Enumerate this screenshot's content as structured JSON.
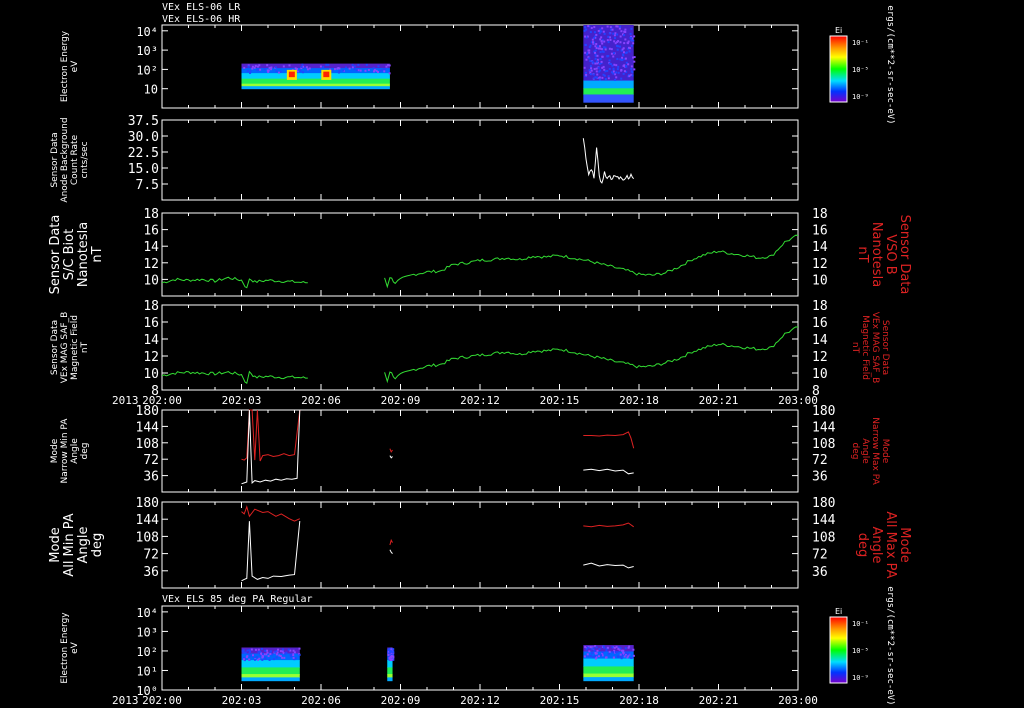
{
  "header": {
    "line1": "VEx ELS-06 LR",
    "line2": "VEx ELS-06 HR"
  },
  "colorbar_units": "ergs/(cm**2-sr-sec-eV)",
  "colorbar_label": "Ei",
  "time_axis": {
    "year": "2013",
    "tick_labels": [
      "202:00",
      "202:03",
      "202:06",
      "202:09",
      "202:12",
      "202:15",
      "202:18",
      "202:21",
      "203:00"
    ],
    "range_hours": [
      0,
      24
    ]
  },
  "chart_data": [
    {
      "panel": "electron-energy-top",
      "type": "heatmap",
      "ylabel": [
        "Electron Energy",
        "eV"
      ],
      "yscale": "log",
      "ylim": [
        1,
        20000
      ],
      "ytick_labels": [
        "10",
        "10²",
        "10³",
        "10⁴"
      ],
      "colorbar": {
        "label": "Ei",
        "ticks": [
          "10⁻¹",
          "10⁻⁵",
          "10⁻⁹"
        ]
      },
      "data_blocks": [
        {
          "t_start": 3.0,
          "t_end": 8.6,
          "e_min": 10,
          "e_max": 200,
          "hotspots_hours": [
            4.9,
            6.2
          ]
        },
        {
          "t_start": 15.9,
          "t_end": 17.8,
          "e_min": 2,
          "e_max": 20000,
          "hotspots_hours": []
        }
      ]
    },
    {
      "panel": "anode-background",
      "type": "line",
      "ylabel": [
        "Sensor Data",
        "Anode Background",
        "Count Rate",
        "cnts/sec"
      ],
      "ylim": [
        0,
        37.5
      ],
      "ytick_labels": [
        "37.5",
        "30.0",
        "22.5",
        "15.0",
        "7.5"
      ],
      "ytick_values": [
        37.5,
        30.0,
        22.5,
        15.0,
        7.5
      ],
      "color": "#ffffff",
      "series": [
        {
          "x": [
            15.9,
            16.0,
            16.1,
            16.2,
            16.3,
            16.4,
            16.5,
            16.6,
            16.7,
            16.8,
            16.9,
            17.0,
            17.1,
            17.2,
            17.3,
            17.4,
            17.5,
            17.6,
            17.7,
            17.8
          ],
          "y": [
            29,
            20,
            12,
            15,
            10,
            25,
            11,
            8,
            13,
            10,
            12,
            9,
            12,
            10,
            11,
            9,
            11,
            10,
            12,
            10
          ]
        }
      ]
    },
    {
      "panel": "sc-biot",
      "type": "line",
      "ylabel": [
        "Sensor Data",
        "S/C Biot",
        "Nanotesla",
        "nT"
      ],
      "ylabel_right": [
        "Sensor Data",
        "VSO B",
        "Nanotesla",
        "nT"
      ],
      "ylim": [
        8,
        18
      ],
      "ytick_labels": [
        "18",
        "16",
        "14",
        "12",
        "10"
      ],
      "ytick_values": [
        18,
        16,
        14,
        12,
        10
      ],
      "color": "#33dd33",
      "series": [
        {
          "x": [
            0,
            0.5,
            1,
            1.5,
            2,
            2.5,
            3,
            3.2,
            3.3,
            3.5,
            4,
            4.5,
            5,
            5.5,
            8.4,
            8.5,
            8.6,
            8.8,
            9,
            9.5,
            10,
            10.5,
            11,
            11.5,
            12,
            12.5,
            13,
            13.5,
            14,
            14.5,
            15,
            15.5,
            16,
            16.5,
            17,
            17.5,
            18,
            18.5,
            19,
            19.5,
            20,
            20.5,
            21,
            21.5,
            22,
            22.5,
            23,
            23.5,
            24
          ],
          "y": [
            9.6,
            10.0,
            9.9,
            10.0,
            9.8,
            10.2,
            9.9,
            8.9,
            10.1,
            9.7,
            9.9,
            9.8,
            9.7,
            9.6,
            10.2,
            9.2,
            10.3,
            9.6,
            10.0,
            10.6,
            10.9,
            11.0,
            11.8,
            12.0,
            12.3,
            12.4,
            12.6,
            12.4,
            12.8,
            12.7,
            12.9,
            12.6,
            12.3,
            11.9,
            11.5,
            11.1,
            10.6,
            10.5,
            10.8,
            11.5,
            12.4,
            13.0,
            13.4,
            13.1,
            12.9,
            12.6,
            12.8,
            14.5,
            15.3
          ]
        }
      ]
    },
    {
      "panel": "mag-saf-b",
      "type": "line",
      "ylabel": [
        "Sensor Data",
        "VEx MAG SAF_B",
        "Magnetic Field",
        "nT"
      ],
      "ylabel_right": [
        "Sensor Data",
        "VEx MAG SAF_B",
        "Magnetic Field",
        "nT"
      ],
      "ylim": [
        8,
        18
      ],
      "ytick_labels": [
        "18",
        "16",
        "14",
        "12",
        "10",
        "8"
      ],
      "ytick_values": [
        18,
        16,
        14,
        12,
        10,
        8
      ],
      "color": "#33dd33",
      "series": [
        {
          "x": [
            0,
            0.5,
            1,
            1.5,
            2,
            2.5,
            3,
            3.2,
            3.3,
            3.5,
            4,
            4.5,
            5,
            5.5,
            8.4,
            8.5,
            8.6,
            8.8,
            9,
            9.5,
            10,
            10.5,
            11,
            11.5,
            12,
            12.5,
            13,
            13.5,
            14,
            14.5,
            15,
            15.5,
            16,
            16.5,
            17,
            17.5,
            18,
            18.5,
            19,
            19.5,
            20,
            20.5,
            21,
            21.5,
            22,
            22.5,
            23,
            23.5,
            24
          ],
          "y": [
            9.7,
            10.0,
            10.1,
            10.0,
            9.9,
            10.1,
            9.8,
            8.7,
            10.2,
            9.5,
            9.6,
            9.5,
            9.5,
            9.4,
            10.1,
            9.1,
            10.2,
            9.4,
            9.8,
            10.4,
            10.8,
            11.0,
            11.7,
            11.9,
            12.1,
            12.3,
            12.5,
            12.2,
            12.6,
            12.6,
            12.8,
            12.5,
            12.1,
            11.8,
            11.4,
            11.1,
            10.7,
            10.8,
            11.2,
            11.7,
            12.5,
            13.0,
            13.4,
            13.2,
            13.0,
            12.8,
            13.0,
            14.6,
            15.4
          ]
        }
      ]
    },
    {
      "panel": "narrow-pa",
      "type": "line",
      "ylabel": [
        "Mode",
        "Narrow Min PA",
        "Angle",
        "deg"
      ],
      "ylabel_right": [
        "Mode",
        "Narrow Max PA",
        "Angle",
        "deg"
      ],
      "ylim": [
        0,
        180
      ],
      "ytick_labels": [
        "180",
        "144",
        "108",
        "72",
        "36"
      ],
      "ytick_values": [
        180,
        144,
        108,
        72,
        36
      ],
      "series": [
        {
          "name": "Max PA",
          "color": "#dd2222",
          "segments": [
            {
              "x": [
                3.0,
                3.1,
                3.2,
                3.3,
                3.4,
                3.5,
                3.6,
                3.7,
                3.8,
                4.0,
                4.2,
                4.4,
                4.6,
                4.8,
                5.0,
                5.2
              ],
              "y": [
                72,
                70,
                75,
                180,
                180,
                70,
                180,
                68,
                80,
                82,
                78,
                80,
                84,
                80,
                82,
                180
              ]
            },
            {
              "x": [
                8.6,
                8.65,
                8.7
              ],
              "y": [
                95,
                88,
                92
              ]
            },
            {
              "x": [
                15.9,
                16.2,
                16.5,
                16.8,
                17.1,
                17.4,
                17.6,
                17.7,
                17.8
              ],
              "y": [
                124,
                124,
                123,
                125,
                124,
                126,
                132,
                118,
                96
              ]
            }
          ]
        },
        {
          "name": "Min PA",
          "color": "#ffffff",
          "segments": [
            {
              "x": [
                3.0,
                3.1,
                3.2,
                3.3,
                3.4,
                3.5,
                3.7,
                3.9,
                4.1,
                4.3,
                4.5,
                4.7,
                4.9,
                5.1,
                5.2
              ],
              "y": [
                18,
                20,
                22,
                180,
                20,
                25,
                22,
                26,
                24,
                28,
                26,
                29,
                28,
                30,
                180
              ]
            },
            {
              "x": [
                8.6,
                8.65,
                8.7
              ],
              "y": [
                80,
                75,
                78
              ]
            },
            {
              "x": [
                15.9,
                16.2,
                16.5,
                16.8,
                17.1,
                17.4,
                17.6,
                17.8
              ],
              "y": [
                48,
                50,
                47,
                50,
                46,
                48,
                40,
                42
              ]
            }
          ]
        }
      ]
    },
    {
      "panel": "all-pa",
      "type": "line",
      "ylabel": [
        "Mode",
        "All Min PA",
        "Angle",
        "deg"
      ],
      "ylabel_right": [
        "Mode",
        "All Max PA",
        "Angle",
        "deg"
      ],
      "ylim": [
        0,
        180
      ],
      "ytick_labels": [
        "180",
        "144",
        "108",
        "72",
        "36"
      ],
      "ytick_values": [
        180,
        144,
        108,
        72,
        36
      ],
      "series": [
        {
          "name": "Max PA",
          "color": "#dd2222",
          "segments": [
            {
              "x": [
                3.0,
                3.1,
                3.2,
                3.3,
                3.5,
                3.8,
                4.0,
                4.3,
                4.5,
                4.8,
                5.0,
                5.2
              ],
              "y": [
                160,
                155,
                170,
                150,
                165,
                158,
                160,
                150,
                155,
                145,
                140,
                145
              ]
            },
            {
              "x": [
                8.6,
                8.65,
                8.7
              ],
              "y": [
                90,
                100,
                95
              ]
            },
            {
              "x": [
                15.9,
                16.2,
                16.5,
                16.8,
                17.1,
                17.4,
                17.6,
                17.8
              ],
              "y": [
                130,
                128,
                131,
                129,
                130,
                132,
                136,
                128
              ]
            }
          ]
        },
        {
          "name": "Min PA",
          "color": "#ffffff",
          "segments": [
            {
              "x": [
                3.0,
                3.1,
                3.2,
                3.3,
                3.4,
                3.6,
                3.8,
                4.0,
                4.2,
                4.5,
                4.8,
                5.0,
                5.2
              ],
              "y": [
                15,
                18,
                20,
                140,
                25,
                18,
                22,
                20,
                25,
                24,
                27,
                28,
                140
              ]
            },
            {
              "x": [
                8.6,
                8.65,
                8.7
              ],
              "y": [
                80,
                75,
                72
              ]
            },
            {
              "x": [
                15.9,
                16.2,
                16.5,
                16.8,
                17.1,
                17.4,
                17.6,
                17.8
              ],
              "y": [
                48,
                52,
                46,
                49,
                47,
                48,
                42,
                45
              ]
            }
          ]
        }
      ]
    },
    {
      "panel": "electron-energy-bottom",
      "type": "heatmap",
      "title": "VEx ELS 85 deg PA Regular",
      "ylabel": [
        "Electron Energy",
        "eV"
      ],
      "yscale": "log",
      "ylim": [
        1,
        20000
      ],
      "ytick_labels": [
        "10⁴",
        "10³",
        "10²",
        "10¹",
        "10⁰"
      ],
      "colorbar": {
        "label": "Ei",
        "ticks": [
          "10⁻¹",
          "10⁻⁵",
          "10⁻⁹"
        ]
      },
      "data_blocks": [
        {
          "t_start": 3.0,
          "t_end": 5.2,
          "e_min": 3,
          "e_max": 150,
          "hotspots_hours": []
        },
        {
          "t_start": 8.5,
          "t_end": 8.7,
          "e_min": 3,
          "e_max": 150,
          "hotspots_hours": []
        },
        {
          "t_start": 15.9,
          "t_end": 17.8,
          "e_min": 3,
          "e_max": 200,
          "hotspots_hours": []
        }
      ]
    }
  ]
}
